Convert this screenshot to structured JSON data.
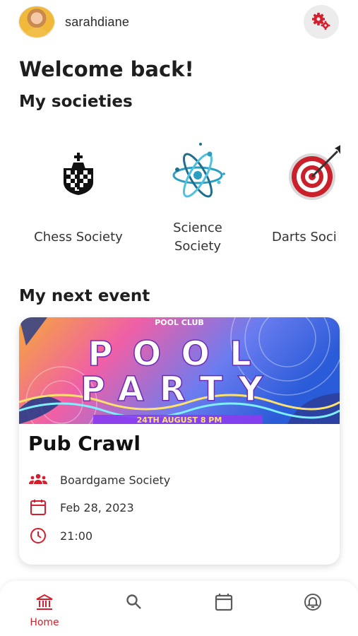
{
  "user": {
    "username": "sarahdiane"
  },
  "header": {
    "welcome": "Welcome back!",
    "my_societies": "My societies",
    "my_next_event": "My next event"
  },
  "societies": [
    {
      "name": "Chess Society",
      "icon": "chess-king-icon"
    },
    {
      "name": "Science Society",
      "icon": "atom-icon"
    },
    {
      "name": "Darts Soci",
      "icon": "dartboard-icon"
    }
  ],
  "event": {
    "banner": {
      "club": "POOL CLUB",
      "line1": "POOL",
      "line2": "PARTY",
      "footer": "24TH  AUGUST  8 PM"
    },
    "title": "Pub Crawl",
    "society": "Boardgame Society",
    "date": "Feb 28, 2023",
    "time": "21:00"
  },
  "nav": {
    "home_label": "Home",
    "items": [
      "home-icon",
      "search-icon",
      "calendar-icon",
      "notification-icon"
    ]
  },
  "colors": {
    "accent": "#d51f2c",
    "icon_gray": "#5a5a5a"
  }
}
